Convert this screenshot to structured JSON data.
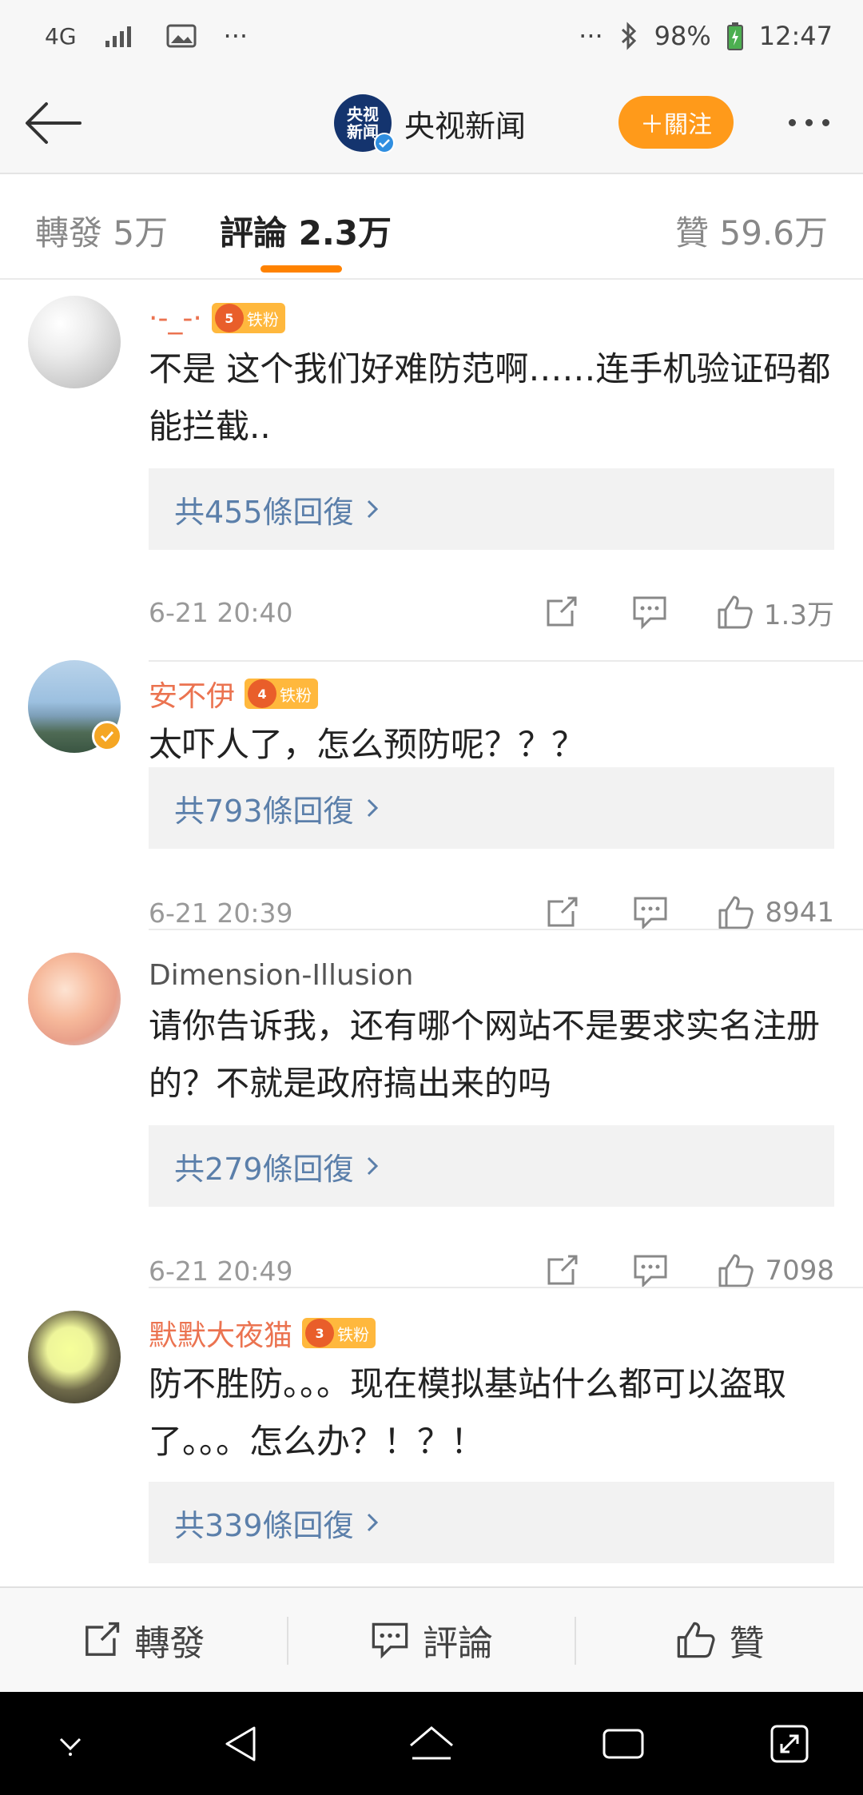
{
  "status_bar": {
    "network": "4G",
    "dots": "···",
    "dots_right": "···",
    "battery": "98%",
    "time": "12:47"
  },
  "header": {
    "account_name": "央视新闻",
    "logo_line1": "央视",
    "logo_line2": "新闻",
    "follow_label": "＋關注"
  },
  "tabs": {
    "repost": "轉發 5万",
    "comment": "評論 2.3万",
    "like": "贊 59.6万"
  },
  "comments": [
    {
      "user": "·-_-·",
      "badge": "铁粉",
      "badge_level": "5",
      "text": "不是 这个我们好难防范啊……连手机验证码都能拦截..",
      "replies": "共455條回復",
      "time": "6-21 20:40",
      "likes": "1.3万"
    },
    {
      "user": "安不伊",
      "badge": "铁粉",
      "badge_level": "4",
      "text": "太吓人了，怎么预防呢？？？",
      "replies": "共793條回復",
      "time": "6-21 20:39",
      "likes": "8941"
    },
    {
      "user": "Dimension-Illusion",
      "text": "请你告诉我，还有哪个网站不是要求实名注册的？不就是政府搞出来的吗",
      "replies": "共279條回復",
      "time": "6-21 20:49",
      "likes": "7098"
    },
    {
      "user": "默默大夜猫",
      "badge": "铁粉",
      "badge_level": "3",
      "text": "防不胜防。。。现在模拟基站什么都可以盗取了。。。怎么办？！？！",
      "replies": "共339條回復"
    }
  ],
  "bottom_bar": {
    "repost": "轉發",
    "comment": "評論",
    "like": "贊"
  },
  "colors": {
    "accent": "#ff8200",
    "follow": "#ff9a1a",
    "username": "#eb7350",
    "reply_link": "#5b7faa"
  }
}
